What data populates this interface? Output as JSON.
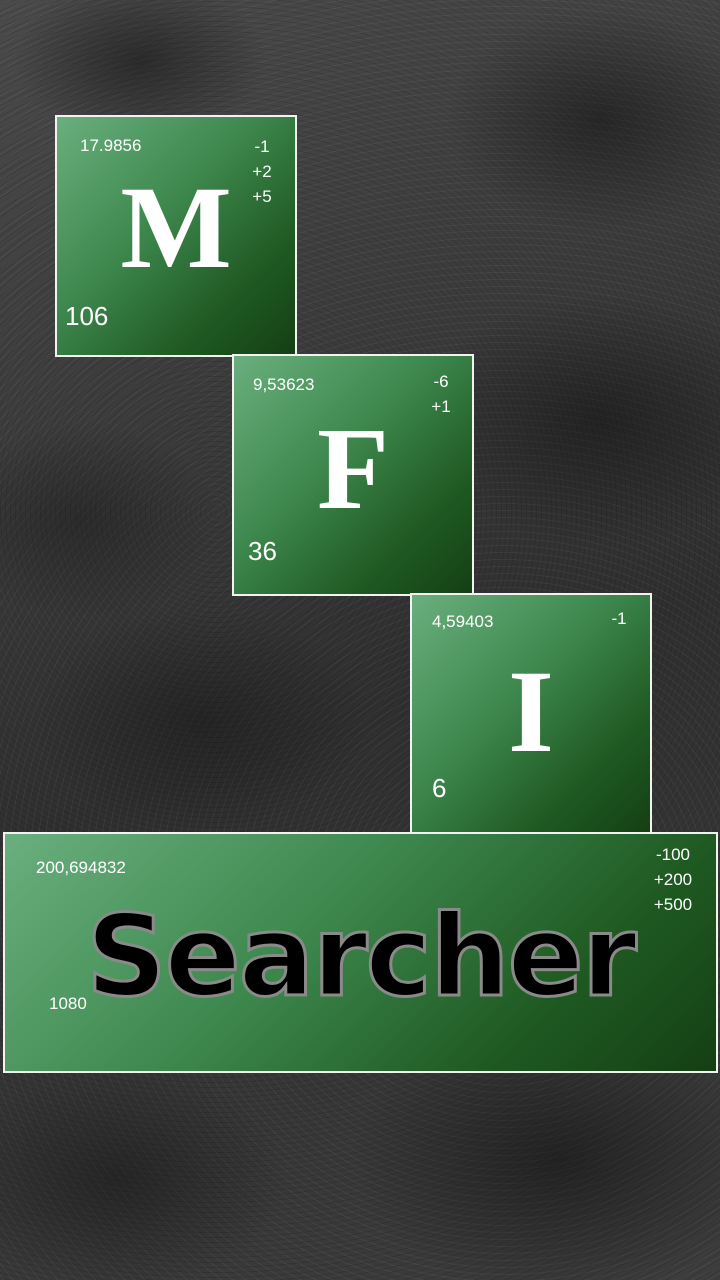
{
  "tiles": [
    {
      "symbol": "M",
      "mass": "17.9856",
      "number": "106",
      "oxidation": [
        "-1",
        "+2",
        "+5"
      ]
    },
    {
      "symbol": "F",
      "mass": "9,53623",
      "number": "36",
      "oxidation": [
        "-6",
        "+1"
      ]
    },
    {
      "symbol": "I",
      "mass": "4,59403",
      "number": "6",
      "oxidation": [
        "-1"
      ]
    }
  ],
  "title_tile": {
    "word": "Searcher",
    "mass": "200,694832",
    "number": "1080",
    "oxidation": [
      "-100",
      "+200",
      "+500"
    ]
  }
}
